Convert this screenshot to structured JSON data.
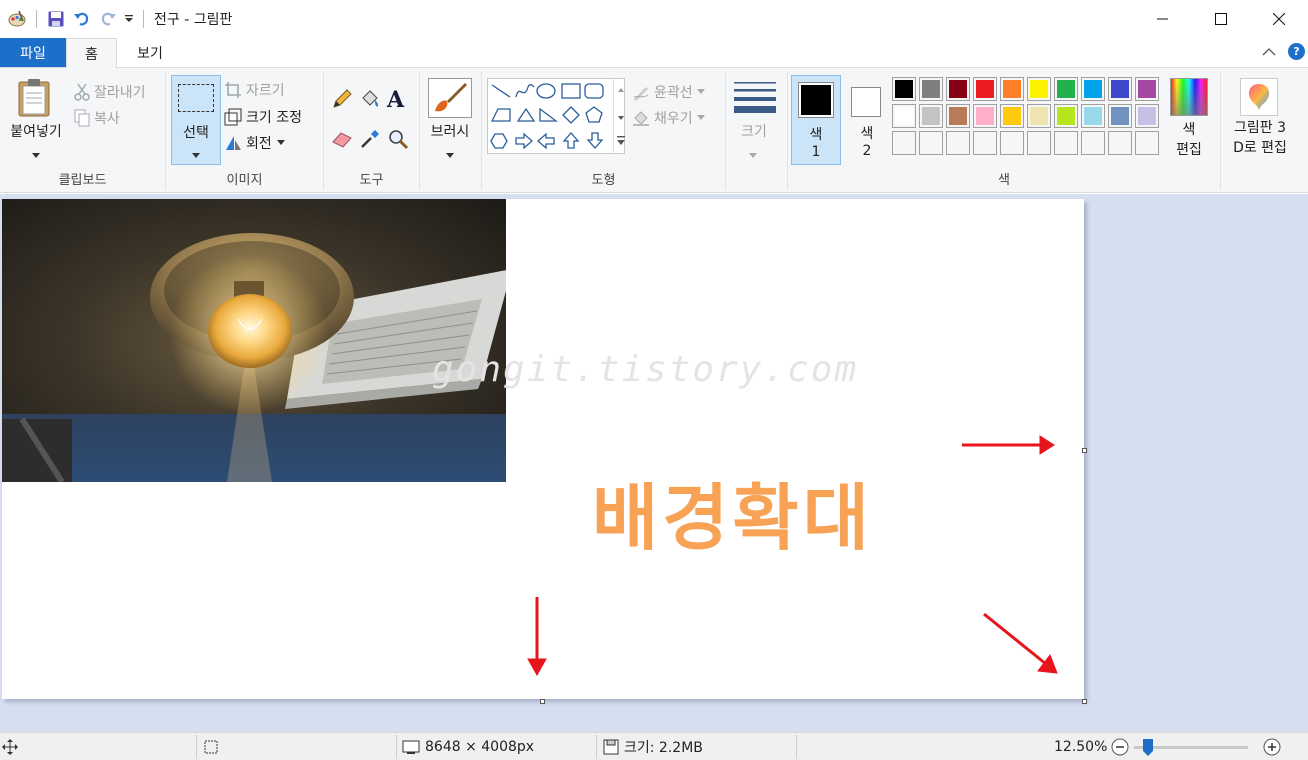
{
  "window": {
    "title": "전구 - 그림판",
    "quick_access": [
      "paint-app-icon",
      "save-icon",
      "undo-icon",
      "redo-icon",
      "customize-dropdown-icon"
    ]
  },
  "tabs": {
    "file": "파일",
    "home": "홈",
    "view": "보기"
  },
  "ribbon": {
    "clipboard": {
      "label": "클립보드",
      "paste": "붙여넣기",
      "cut": "잘라내기",
      "copy": "복사"
    },
    "image": {
      "label": "이미지",
      "select": "선택",
      "crop": "자르기",
      "resize": "크기 조정",
      "rotate": "회전"
    },
    "tools": {
      "label": "도구"
    },
    "brushes": {
      "label": "브러시"
    },
    "shapes": {
      "label": "도형",
      "outline": "윤곽선",
      "fill": "채우기"
    },
    "size": {
      "label": "크기"
    },
    "colors": {
      "label": "색",
      "color1_a": "색",
      "color1_b": "1",
      "color2_a": "색",
      "color2_b": "2",
      "edit_a": "색",
      "edit_b": "편집",
      "color1_value": "#000000",
      "color2_value": "#ffffff",
      "palette_row1": [
        "#000000",
        "#7f7f7f",
        "#880015",
        "#ed1c24",
        "#ff7f27",
        "#fff200",
        "#22b14c",
        "#00a2e8",
        "#3f48cc",
        "#a349a4"
      ],
      "palette_row2": [
        "#ffffff",
        "#c3c3c3",
        "#b97a57",
        "#ffaec9",
        "#ffc90e",
        "#efe4b0",
        "#b5e61d",
        "#99d9ea",
        "#7092be",
        "#c8bfe7"
      ]
    },
    "paint3d": {
      "line1": "그림판 3",
      "line2": "D로 편집"
    }
  },
  "canvas": {
    "watermark": "gongit.tistory.com",
    "overlay_text": "배경확대",
    "overlay_color": "#f7a254",
    "arrow_color": "#e8141b"
  },
  "status": {
    "dimensions": "8648 × 4008px",
    "file_size": "크기: 2.2MB",
    "zoom": "12.50%",
    "zoom_fraction": 0.12
  }
}
